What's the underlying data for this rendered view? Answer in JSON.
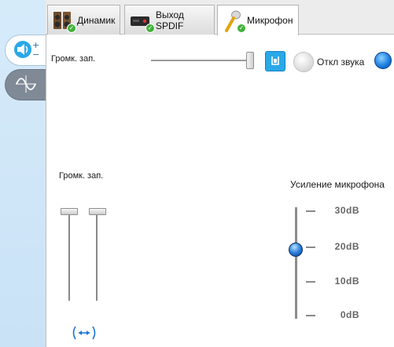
{
  "tabs": [
    {
      "label": "Динамик",
      "icon": "speakers-icon",
      "status": "ok"
    },
    {
      "label": "Выход SPDIF",
      "icon": "spdif-device-icon",
      "status": "ok"
    },
    {
      "label": "Микрофон",
      "icon": "microphone-icon",
      "status": "ok",
      "active": true
    }
  ],
  "sidebar": {
    "items": [
      {
        "icon": "volume-adjust-icon",
        "active": true
      },
      {
        "icon": "waveform-icon",
        "active": false
      }
    ]
  },
  "record_volume": {
    "label": "Громк. зап.",
    "level": 1.0,
    "mute_label": "Откл звука"
  },
  "channels": {
    "label": "Громк. зап.",
    "left_level": 1.0,
    "right_level": 1.0,
    "link_icon": "link-channels-icon"
  },
  "mic_boost": {
    "label": "Усиление микрофона",
    "ticks": [
      "30dB",
      "20dB",
      "10dB",
      "0dB"
    ],
    "value_db": 20
  },
  "colors": {
    "accent": "#2aa8e8",
    "status_ok": "#41b23a",
    "orb_blue": "#1e7fe0"
  }
}
